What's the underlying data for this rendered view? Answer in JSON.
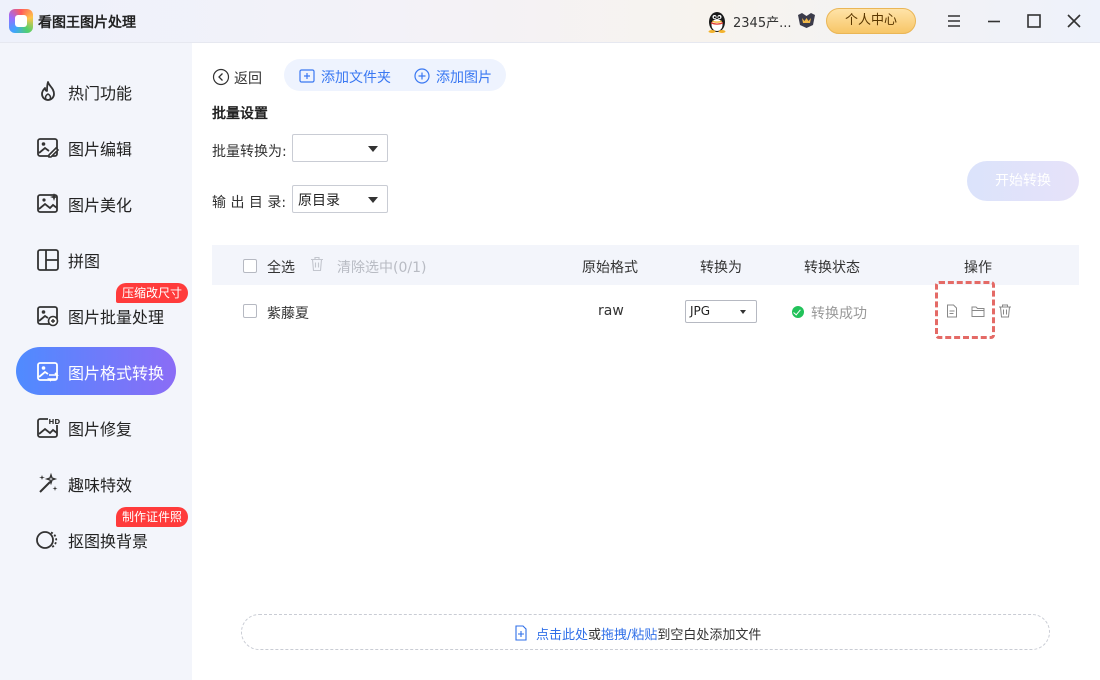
{
  "titlebar": {
    "app_title": "看图王图片处理",
    "user_name": "2345产...",
    "personal_center": "个人中心"
  },
  "sidebar": {
    "items": [
      {
        "label": "热门功能",
        "icon": "fire-icon"
      },
      {
        "label": "图片编辑",
        "icon": "image-edit-icon"
      },
      {
        "label": "图片美化",
        "icon": "image-beautify-icon"
      },
      {
        "label": "拼图",
        "icon": "collage-icon"
      },
      {
        "label": "图片批量处理",
        "icon": "image-batch-icon",
        "badge": "压缩改尺寸"
      },
      {
        "label": "图片格式转换",
        "icon": "image-convert-icon",
        "active": true
      },
      {
        "label": "图片修复",
        "icon": "hd-image-icon"
      },
      {
        "label": "趣味特效",
        "icon": "magic-wand-icon"
      },
      {
        "label": "抠图换背景",
        "icon": "cutout-icon",
        "badge": "制作证件照"
      }
    ]
  },
  "toolbar": {
    "back": "返回",
    "add_folder": "添加文件夹",
    "add_image": "添加图片"
  },
  "settings": {
    "title": "批量设置",
    "convert_to_label": "批量转换为:",
    "convert_to_value": "",
    "output_dir_label": "输 出 目 录:",
    "output_dir_value": "原目录",
    "start_button": "开始转换"
  },
  "table": {
    "select_all": "全选",
    "clear_selected": "清除选中(0/1)",
    "columns": [
      "原始格式",
      "转换为",
      "转换状态",
      "操作"
    ],
    "rows": [
      {
        "name": "紫藤夏",
        "original_format": "raw",
        "convert_to": "JPG",
        "status": "转换成功"
      }
    ]
  },
  "dropzone": {
    "click_here": "点击此处",
    "or": "或",
    "drag_paste": "拖拽/粘贴",
    "rest": "到空白处添加文件"
  },
  "colors": {
    "accent": "#3a78f2",
    "active_gradient_start": "#4f8bff",
    "active_gradient_end": "#8b6cf6",
    "badge": "#ff3b3b",
    "success": "#22c25a",
    "highlight": "#e46a66"
  }
}
